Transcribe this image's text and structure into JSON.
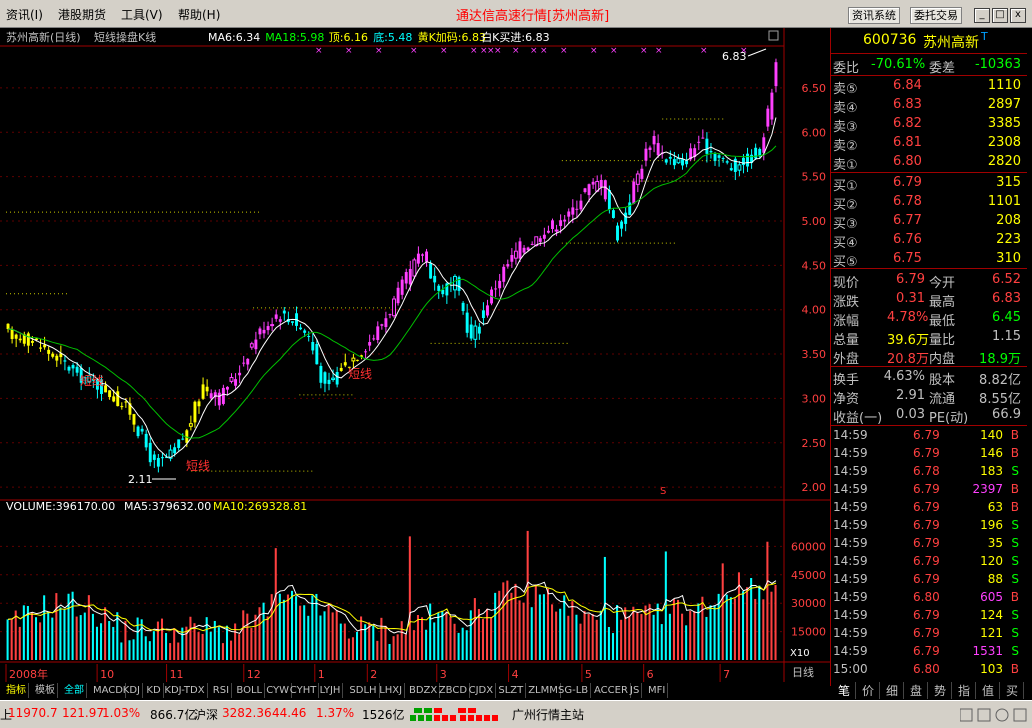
{
  "menu": {
    "items": [
      "资讯(I)",
      "港股期货",
      "工具(V)",
      "帮助(H)"
    ],
    "title": "通达信高速行情",
    "title_stock": "[苏州高新]",
    "btn_info": "资讯系统",
    "btn_trade": "委托交易",
    "win_min": "_",
    "win_max": "□",
    "win_close": "x"
  },
  "chart": {
    "header_name": "苏州高新(日线)",
    "header_type": "短线操盘K线",
    "indicators": [
      {
        "text": "MA6:6.34",
        "color": "#ffffff"
      },
      {
        "text": "MA18:5.98",
        "color": "#00ff00"
      },
      {
        "text": "顶:6.16",
        "color": "#ffff00"
      },
      {
        "text": "底:5.48",
        "color": "#00ffff"
      },
      {
        "text": "黄K加码:6.83",
        "color": "#ffff00"
      },
      {
        "text": "白K买进:6.83",
        "color": "#ffffff"
      }
    ],
    "top_max_label": "6.83",
    "low_label": "2.11",
    "signal_text": "短线",
    "s_marker": "S",
    "vol_indicators": [
      {
        "text": "VOLUME:396170.00",
        "color": "#ffffff"
      },
      {
        "text": "MA5:379632.00",
        "color": "#ffffff"
      },
      {
        "text": "MA10:269328.81",
        "color": "#ffff00"
      }
    ],
    "x10_label": "X10",
    "period_label": "日线",
    "price_axis": [
      6.5,
      6.0,
      5.5,
      5.0,
      4.5,
      4.0,
      3.5,
      3.0,
      2.5,
      2.0
    ],
    "volume_axis": [
      60000,
      45000,
      30000,
      15000
    ],
    "volume_axis_labels": [
      "60000",
      "45000",
      "30000",
      "15000"
    ],
    "price_axis_labels": [
      "6.50",
      "6.00",
      "5.50",
      "5.00",
      "4.50",
      "4.00",
      "3.50",
      "3.00",
      "2.50",
      "2.00"
    ],
    "months": [
      {
        "label": "2008年",
        "frac": 0.0
      },
      {
        "label": "10",
        "frac": 0.118
      },
      {
        "label": "11",
        "frac": 0.208
      },
      {
        "label": "12",
        "frac": 0.308
      },
      {
        "label": "1",
        "frac": 0.4
      },
      {
        "label": "2",
        "frac": 0.468
      },
      {
        "label": "3",
        "frac": 0.558
      },
      {
        "label": "4",
        "frac": 0.651
      },
      {
        "label": "5",
        "frac": 0.746
      },
      {
        "label": "6",
        "frac": 0.826
      },
      {
        "label": "7",
        "frac": 0.925
      }
    ],
    "anchors": [
      {
        "i": 0,
        "p": 3.72
      },
      {
        "i": 6,
        "p": 3.66
      },
      {
        "i": 12,
        "p": 3.45
      },
      {
        "i": 18,
        "p": 3.25
      },
      {
        "i": 24,
        "p": 3.1
      },
      {
        "i": 30,
        "p": 2.85
      },
      {
        "i": 36,
        "p": 2.25
      },
      {
        "i": 40,
        "p": 2.35
      },
      {
        "i": 44,
        "p": 2.62
      },
      {
        "i": 48,
        "p": 3.15
      },
      {
        "i": 52,
        "p": 3.0
      },
      {
        "i": 56,
        "p": 3.25
      },
      {
        "i": 61,
        "p": 3.7
      },
      {
        "i": 66,
        "p": 3.95
      },
      {
        "i": 70,
        "p": 3.9
      },
      {
        "i": 74,
        "p": 3.7
      },
      {
        "i": 78,
        "p": 3.1
      },
      {
        "i": 82,
        "p": 3.35
      },
      {
        "i": 86,
        "p": 3.5
      },
      {
        "i": 90,
        "p": 3.7
      },
      {
        "i": 94,
        "p": 4.0
      },
      {
        "i": 98,
        "p": 4.35
      },
      {
        "i": 102,
        "p": 4.65
      },
      {
        "i": 106,
        "p": 4.2
      },
      {
        "i": 110,
        "p": 4.3
      },
      {
        "i": 114,
        "p": 3.65
      },
      {
        "i": 118,
        "p": 4.1
      },
      {
        "i": 122,
        "p": 4.45
      },
      {
        "i": 126,
        "p": 4.7
      },
      {
        "i": 130,
        "p": 4.8
      },
      {
        "i": 134,
        "p": 4.95
      },
      {
        "i": 138,
        "p": 5.05
      },
      {
        "i": 142,
        "p": 5.35
      },
      {
        "i": 146,
        "p": 5.45
      },
      {
        "i": 150,
        "p": 4.85
      },
      {
        "i": 154,
        "p": 5.4
      },
      {
        "i": 158,
        "p": 5.9
      },
      {
        "i": 162,
        "p": 5.7
      },
      {
        "i": 166,
        "p": 5.65
      },
      {
        "i": 170,
        "p": 5.9
      },
      {
        "i": 174,
        "p": 5.75
      },
      {
        "i": 178,
        "p": 5.6
      },
      {
        "i": 182,
        "p": 5.7
      },
      {
        "i": 185,
        "p": 5.8
      },
      {
        "i": 187,
        "p": 6.2
      },
      {
        "i": 189,
        "p": 6.79
      }
    ],
    "ref_lines": [
      {
        "p": 5.1,
        "x0": 0.0,
        "x1": 0.33
      },
      {
        "p": 4.18,
        "x0": 0.0,
        "x1": 0.08
      },
      {
        "p": 4.02,
        "x0": 0.32,
        "x1": 0.5
      },
      {
        "p": 3.62,
        "x0": 0.55,
        "x1": 0.73
      },
      {
        "p": 2.18,
        "x0": 0.24,
        "x1": 0.4
      },
      {
        "p": 3.04,
        "x0": 0.38,
        "x1": 0.45
      },
      {
        "p": 4.75,
        "x0": 0.72,
        "x1": 0.87
      },
      {
        "p": 5.68,
        "x0": 0.72,
        "x1": 0.93
      },
      {
        "p": 6.15,
        "x0": 0.85,
        "x1": 0.93
      },
      {
        "p": 5.45,
        "x0": 0.8,
        "x1": 0.93
      }
    ]
  },
  "quote": {
    "code": "600736",
    "name": "苏州高新",
    "name_suffix": "T",
    "wb_label": "委比",
    "wb_value": "-70.61%",
    "wc_label": "委差",
    "wc_value": "-10363",
    "asks": [
      {
        "label": "卖⑤",
        "price": "6.84",
        "vol": "1110"
      },
      {
        "label": "卖④",
        "price": "6.83",
        "vol": "2897"
      },
      {
        "label": "卖③",
        "price": "6.82",
        "vol": "3385"
      },
      {
        "label": "卖②",
        "price": "6.81",
        "vol": "2308"
      },
      {
        "label": "卖①",
        "price": "6.80",
        "vol": "2820"
      }
    ],
    "bids": [
      {
        "label": "买①",
        "price": "6.79",
        "vol": "315"
      },
      {
        "label": "买②",
        "price": "6.78",
        "vol": "1101"
      },
      {
        "label": "买③",
        "price": "6.77",
        "vol": "208"
      },
      {
        "label": "买④",
        "price": "6.76",
        "vol": "223"
      },
      {
        "label": "买⑤",
        "price": "6.75",
        "vol": "310"
      }
    ],
    "stats": [
      {
        "l1": "现价",
        "v1": "6.79",
        "c1": "#ff4040",
        "l2": "今开",
        "v2": "6.52",
        "c2": "#ff4040"
      },
      {
        "l1": "涨跌",
        "v1": "0.31",
        "c1": "#ff4040",
        "l2": "最高",
        "v2": "6.83",
        "c2": "#ff4040"
      },
      {
        "l1": "涨幅",
        "v1": "4.78%",
        "c1": "#ff4040",
        "l2": "最低",
        "v2": "6.45",
        "c2": "#00ff00"
      },
      {
        "l1": "总量",
        "v1": "39.6万",
        "c1": "#ffff00",
        "l2": "量比",
        "v2": "1.15",
        "c2": "#c0c0c0"
      },
      {
        "l1": "外盘",
        "v1": "20.8万",
        "c1": "#ff4040",
        "l2": "内盘",
        "v2": "18.9万",
        "c2": "#00ff00"
      }
    ],
    "stats2": [
      {
        "l1": "换手",
        "v1": "4.63%",
        "l2": "股本",
        "v2": "8.82亿"
      },
      {
        "l1": "净资",
        "v1": "2.91",
        "l2": "流通",
        "v2": "8.55亿"
      },
      {
        "l1": "收益(一)",
        "v1": "0.03",
        "l2": "PE(动)",
        "v2": "66.9"
      }
    ],
    "ticks": [
      {
        "time": "14:59",
        "price": "6.79",
        "vol": "140",
        "side": "B"
      },
      {
        "time": "14:59",
        "price": "6.79",
        "vol": "146",
        "side": "B"
      },
      {
        "time": "14:59",
        "price": "6.78",
        "vol": "183",
        "side": "S"
      },
      {
        "time": "14:59",
        "price": "6.79",
        "vol": "2397",
        "side": "B"
      },
      {
        "time": "14:59",
        "price": "6.79",
        "vol": "63",
        "side": "B"
      },
      {
        "time": "14:59",
        "price": "6.79",
        "vol": "196",
        "side": "S"
      },
      {
        "time": "14:59",
        "price": "6.79",
        "vol": "35",
        "side": "S"
      },
      {
        "time": "14:59",
        "price": "6.79",
        "vol": "120",
        "side": "S"
      },
      {
        "time": "14:59",
        "price": "6.79",
        "vol": "88",
        "side": "S"
      },
      {
        "time": "14:59",
        "price": "6.80",
        "vol": "605",
        "side": "B"
      },
      {
        "time": "14:59",
        "price": "6.79",
        "vol": "124",
        "side": "S"
      },
      {
        "time": "14:59",
        "price": "6.79",
        "vol": "121",
        "side": "S"
      },
      {
        "time": "14:59",
        "price": "6.79",
        "vol": "1531",
        "side": "S"
      },
      {
        "time": "15:00",
        "price": "6.80",
        "vol": "103",
        "side": "B"
      }
    ],
    "tabs": [
      "笔",
      "价",
      "细",
      "盘",
      "势",
      "指",
      "值",
      "买"
    ]
  },
  "bottom_tabs": [
    "指标",
    "模板",
    "全部",
    "MACD",
    "KDJ",
    "KD",
    "KDJ-TDX",
    "RSI",
    "BOLL",
    "CYW",
    "CYHT",
    "LYJH",
    "SDLH",
    "LHXJ",
    "BDZX",
    "ZBCD",
    "CJDX",
    "SLZT",
    "ZLMM",
    "SG-LB",
    "ACCER",
    "JS",
    "MFI"
  ],
  "status": {
    "sh_index": "11970.7",
    "sh_change": "121.97",
    "sh_pct": "1.03%",
    "sh_amount": "866.7亿",
    "sz_label": "沪深",
    "sz_index": "3282.36",
    "sz_change": "44.46",
    "sz_pct": "1.37%",
    "sz_amount": "1526亿",
    "site": "广州行情主站"
  },
  "colors": {
    "up": "#ff4040",
    "down": "#00ff00",
    "magenta": "#ff40ff",
    "cyan": "#00ffff",
    "yellow": "#ffff00"
  }
}
